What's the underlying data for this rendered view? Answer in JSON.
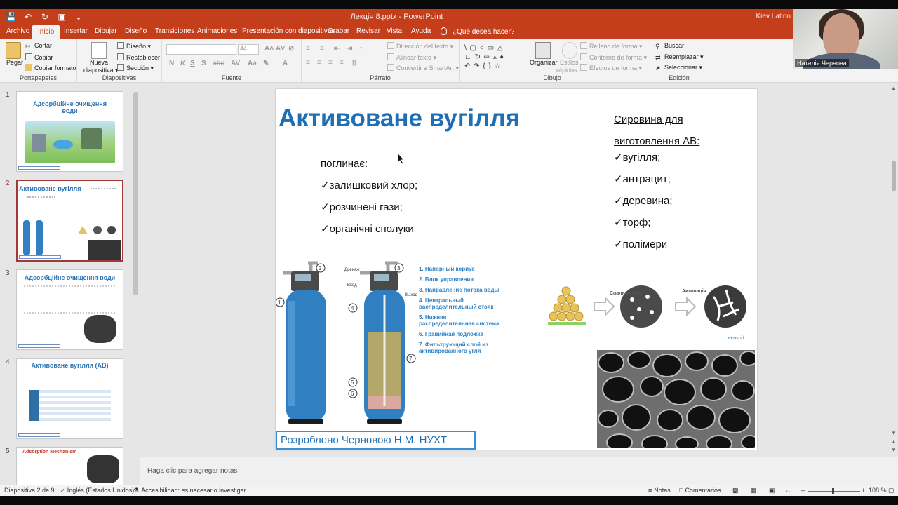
{
  "window": {
    "title": "Лекція 8.pptx  -  PowerPoint",
    "font_indicator": "Kiev Latino"
  },
  "tabs": [
    {
      "label": "Archivo",
      "active": false
    },
    {
      "label": "Inicio",
      "active": true
    },
    {
      "label": "Insertar",
      "active": false
    },
    {
      "label": "Dibujar",
      "active": false
    },
    {
      "label": "Diseño",
      "active": false
    },
    {
      "label": "Transiciones",
      "active": false
    },
    {
      "label": "Animaciones",
      "active": false
    },
    {
      "label": "Presentación con diapositivas",
      "active": false
    },
    {
      "label": "Grabar",
      "active": false
    },
    {
      "label": "Revisar",
      "active": false
    },
    {
      "label": "Vista",
      "active": false
    },
    {
      "label": "Ayuda",
      "active": false
    }
  ],
  "tell_me": "¿Qué desea hacer?",
  "ribbon": {
    "clipboard": {
      "paste": "Pegar",
      "cut": "Cortar",
      "copy": "Copiar",
      "format_painter": "Copiar formato",
      "label": "Portapapeles"
    },
    "slides": {
      "new_slide_1": "Nueva",
      "new_slide_2": "diapositiva",
      "layout": "Diseño",
      "reset": "Restablecer",
      "section": "Sección",
      "label": "Diapositivas"
    },
    "font": {
      "size": "44",
      "label": "Fuente"
    },
    "paragraph": {
      "text_direction": "Dirección del texto",
      "align_text": "Alinear texto",
      "smartart": "Convertir a SmartArt",
      "label": "Párrafo"
    },
    "drawing": {
      "arrange": "Organizar",
      "quick_styles_1": "Estilos",
      "quick_styles_2": "rápidos",
      "fill": "Relleno de forma",
      "outline": "Contorno de forma",
      "effects": "Efectos de forma",
      "label": "Dibujo"
    },
    "editing": {
      "find": "Buscar",
      "replace": "Reemplazar",
      "select": "Seleccionar",
      "label": "Edición"
    }
  },
  "webcam": {
    "name": "Наталія Чернова"
  },
  "thumbnails": [
    {
      "num": "1",
      "title": "Адсорбційне очищення води"
    },
    {
      "num": "2",
      "title": "Активоване вугілля"
    },
    {
      "num": "3",
      "title": "Адсорбційне очищення води"
    },
    {
      "num": "4",
      "title": "Активоване вугілля (АВ)"
    },
    {
      "num": "5",
      "title": "Adsorption Mechanism"
    }
  ],
  "slide": {
    "title": "Активоване вугілля",
    "absorbs_label": "поглинає:",
    "absorbs": [
      "✓залишковий хлор;",
      "✓розчинені гази;",
      "✓органічні сполуки"
    ],
    "raw_title_1": "Сировина для",
    "raw_title_2": "виготовлення АВ:",
    "raw": [
      "✓вугілля;",
      "✓антрацит;",
      "✓деревина;",
      "✓торф;",
      "✓полімери"
    ],
    "filter_legend": [
      "1. Напорный корпус",
      "2. Блок управления",
      "3. Направление потока воды",
      "4. Центральный",
      "    распределительный стояк",
      "5. Нижняя",
      "    распределительная система",
      "6. Гравийная подложка",
      "7. Фильтрующий слой из",
      "    активированного угля"
    ],
    "drain_label": "Дренаж",
    "in_label": "Вход",
    "out_label": "Выход",
    "burn_label": "Спалювання",
    "activation_label": "Активація",
    "brand": "ecosoft",
    "credit": "Розроблено Черновою Н.М. НУХТ"
  },
  "notes_placeholder": "Haga clic para agregar notas",
  "status": {
    "slide_pos": "Diapositiva 2 de 9",
    "language": "Inglés (Estados Unidos)",
    "accessibility": "Accesibilidad: es necesario investigar",
    "notes": "Notas",
    "comments": "Comentarios",
    "zoom": "108 %"
  },
  "colors": {
    "accent": "#c43e1c",
    "title_blue": "#1f6fb4",
    "selected_thumb": "#a4373a"
  }
}
